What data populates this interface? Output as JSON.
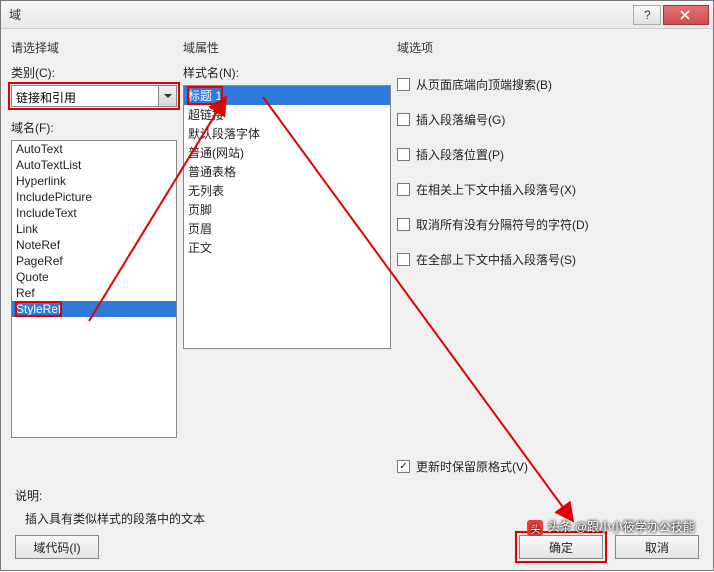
{
  "window": {
    "title": "域"
  },
  "col1": {
    "header": "请选择域",
    "category_label": "类别(C):",
    "category_value": "链接和引用",
    "names_label": "域名(F):",
    "names": [
      "AutoText",
      "AutoTextList",
      "Hyperlink",
      "IncludePicture",
      "IncludeText",
      "Link",
      "NoteRef",
      "PageRef",
      "Quote",
      "Ref",
      "StyleRef"
    ],
    "selected_name": "StyleRef"
  },
  "col2": {
    "header": "域属性",
    "styles_label": "样式名(N):",
    "styles": [
      "标题 1",
      "超链接",
      "默认段落字体",
      "普通(网站)",
      "普通表格",
      "无列表",
      "页脚",
      "页眉",
      "正文"
    ],
    "selected_style": "标题 1"
  },
  "col3": {
    "header": "域选项",
    "options": [
      {
        "label": "从页面底端向顶端搜索(B)",
        "checked": false
      },
      {
        "label": "插入段落编号(G)",
        "checked": false
      },
      {
        "label": "插入段落位置(P)",
        "checked": false
      },
      {
        "label": "在相关上下文中插入段落号(X)",
        "checked": false
      },
      {
        "label": "取消所有没有分隔符号的字符(D)",
        "checked": false
      },
      {
        "label": "在全部上下文中插入段落号(S)",
        "checked": false
      }
    ],
    "preserve": {
      "label": "更新时保留原格式(V)",
      "checked": true
    }
  },
  "desc": {
    "label": "说明:",
    "text": "插入具有类似样式的段落中的文本"
  },
  "buttons": {
    "codes": "域代码(I)",
    "ok": "确定",
    "cancel": "取消"
  },
  "watermark": "头条 @跟小小筱学办公技能"
}
